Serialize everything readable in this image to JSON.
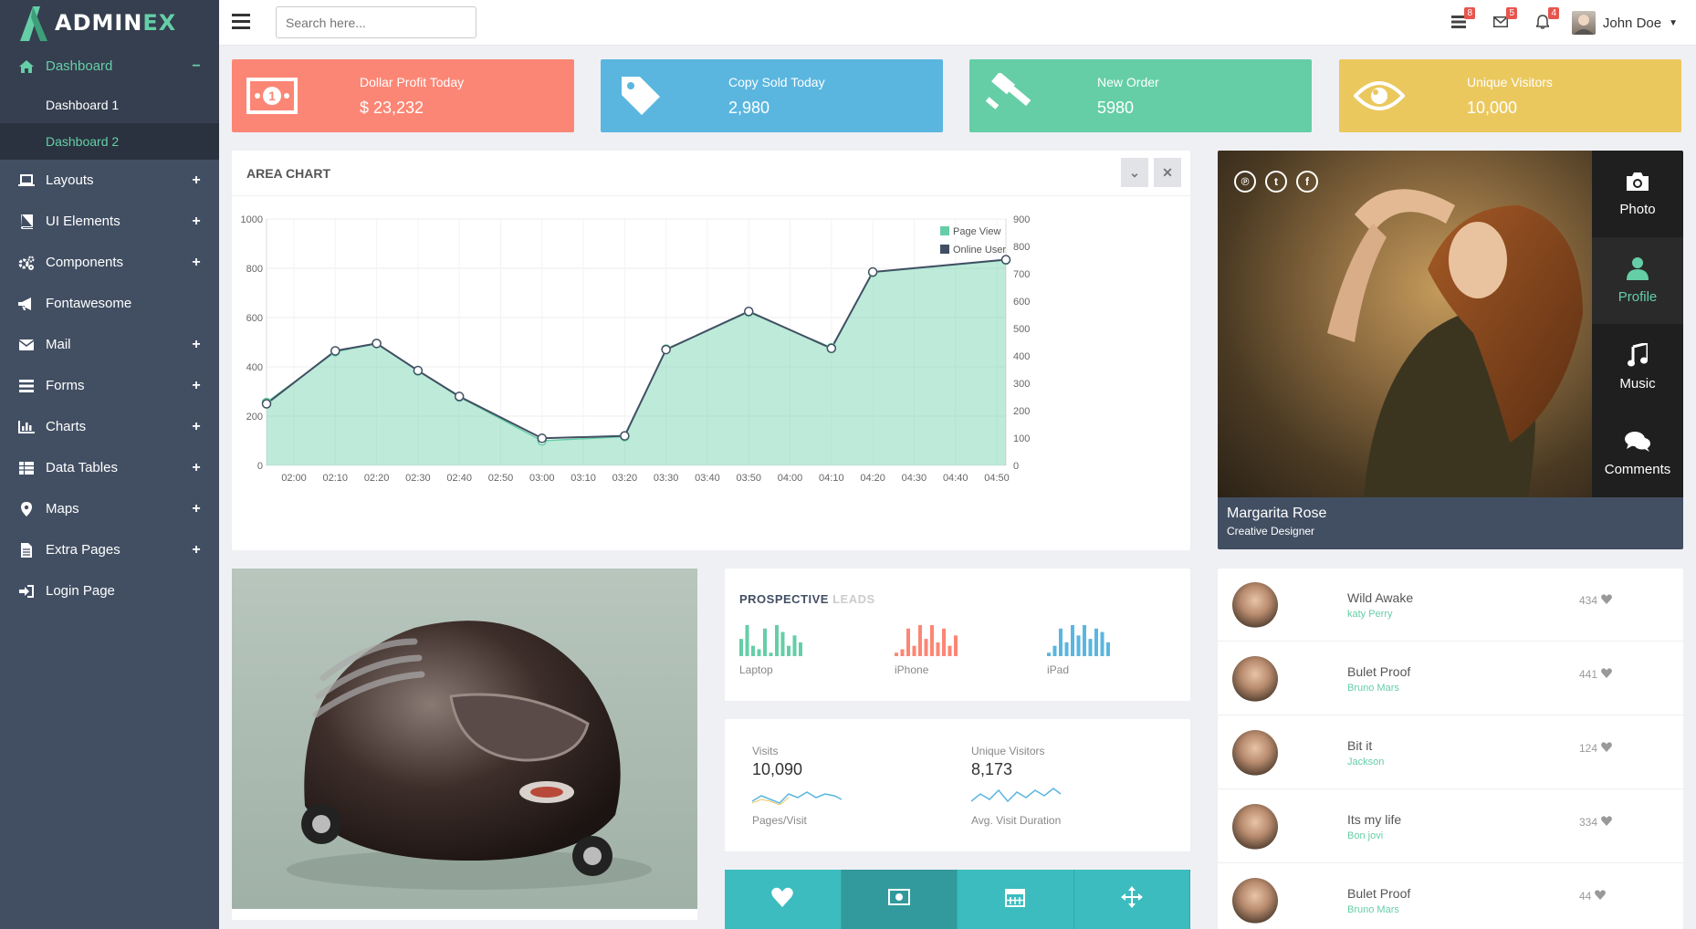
{
  "brand": {
    "name_a": "ADMIN",
    "name_b": "EX"
  },
  "sidebar": {
    "items": [
      {
        "label": "Dashboard",
        "icon": "home-icon",
        "toggle": "−"
      },
      {
        "label": "Layouts",
        "icon": "laptop-icon",
        "toggle": "+"
      },
      {
        "label": "UI Elements",
        "icon": "book-icon",
        "toggle": "+"
      },
      {
        "label": "Components",
        "icon": "cogs-icon",
        "toggle": "+"
      },
      {
        "label": "Fontawesome",
        "icon": "bullhorn-icon",
        "toggle": ""
      },
      {
        "label": "Mail",
        "icon": "envelope-icon",
        "toggle": "+"
      },
      {
        "label": "Forms",
        "icon": "tasks-icon",
        "toggle": "+"
      },
      {
        "label": "Charts",
        "icon": "bar-chart-icon",
        "toggle": "+"
      },
      {
        "label": "Data Tables",
        "icon": "table-icon",
        "toggle": "+"
      },
      {
        "label": "Maps",
        "icon": "map-marker-icon",
        "toggle": "+"
      },
      {
        "label": "Extra Pages",
        "icon": "file-icon",
        "toggle": "+"
      },
      {
        "label": "Login Page",
        "icon": "sign-in-icon",
        "toggle": ""
      }
    ],
    "sub": [
      "Dashboard 1",
      "Dashboard 2"
    ]
  },
  "header": {
    "search_placeholder": "Search here...",
    "badges": {
      "tasks": "8",
      "mail": "5",
      "bell": "4"
    },
    "user": "John Doe"
  },
  "stats": [
    {
      "title": "Dollar Profit Today",
      "value": "$ 23,232",
      "color": "#fc8675",
      "icon": "money-icon"
    },
    {
      "title": "Copy Sold Today",
      "value": "2,980",
      "color": "#5ab6df",
      "icon": "tag-icon"
    },
    {
      "title": "New Order",
      "value": "5980",
      "color": "#65cea7",
      "icon": "gavel-icon"
    },
    {
      "title": "Unique Visitors",
      "value": "10,000",
      "color": "#ebc85e",
      "icon": "eye-icon"
    }
  ],
  "area_chart_panel": {
    "title": "AREA CHART"
  },
  "chart_data": {
    "type": "area",
    "categories": [
      "02:00",
      "02:10",
      "02:20",
      "02:30",
      "02:40",
      "02:50",
      "03:00",
      "03:10",
      "03:20",
      "03:30",
      "03:40",
      "03:50",
      "04:00",
      "04:10",
      "04:20",
      "04:30",
      "04:40",
      "04:50"
    ],
    "x_points": [
      "02:00",
      "02:10",
      "02:20",
      "02:30",
      "02:40",
      "03:00",
      "03:20",
      "03:30",
      "03:50",
      "04:10",
      "04:20",
      "04:40",
      "04:50"
    ],
    "series": [
      {
        "name": "Page View",
        "axis": "left",
        "color": "#65cea7",
        "values": [
          250,
          465,
          495,
          385,
          280,
          110,
          120,
          470,
          625,
          475,
          785,
          835
        ]
      },
      {
        "name": "Online User",
        "axis": "right",
        "color": "#424f63",
        "values": [
          230,
          415,
          445,
          345,
          250,
          90,
          105,
          425,
          560,
          430,
          705,
          750
        ]
      }
    ],
    "left_ylim": [
      0,
      1000
    ],
    "left_ticks": [
      "0",
      "200",
      "400",
      "600",
      "800",
      "1000"
    ],
    "right_ylim": [
      0,
      900
    ],
    "right_ticks": [
      "0",
      "100",
      "200",
      "300",
      "400",
      "500",
      "600",
      "700",
      "800",
      "900"
    ],
    "legend": "top-right",
    "grid": true
  },
  "profile": {
    "name": "Margarita Rose",
    "role": "Creative Designer",
    "tabs": [
      {
        "label": "Photo",
        "icon": "camera-icon"
      },
      {
        "label": "Profile",
        "icon": "user-icon"
      },
      {
        "label": "Music",
        "icon": "music-icon"
      },
      {
        "label": "Comments",
        "icon": "comments-icon"
      }
    ],
    "social": [
      "pinterest-icon",
      "twitter-icon",
      "facebook-icon"
    ]
  },
  "leads": {
    "title_a": "PROSPECTIVE",
    "title_b": "LEADS",
    "items": [
      {
        "label": "Laptop",
        "color": "#65cea7",
        "bars": [
          5,
          9,
          3,
          2,
          8,
          1,
          9,
          7,
          3,
          6,
          4
        ]
      },
      {
        "label": "iPhone",
        "color": "#fc8675",
        "bars": [
          1,
          2,
          8,
          3,
          9,
          5,
          9,
          4,
          8,
          3,
          6
        ]
      },
      {
        "label": "iPad",
        "color": "#5ab6df",
        "bars": [
          1,
          3,
          8,
          4,
          9,
          6,
          9,
          5,
          8,
          7,
          4
        ]
      }
    ]
  },
  "visits": {
    "visits_label": "Visits",
    "visits_value": "10,090",
    "pages_label": "Pages/Visit",
    "unique_label": "Unique Visitors",
    "unique_value": "8,173",
    "duration_label": "Avg. Visit Duration"
  },
  "songs": [
    {
      "title": "Wild Awake",
      "artist": "katy Perry",
      "count": "434"
    },
    {
      "title": "Bulet Proof",
      "artist": "Bruno Mars",
      "count": "441"
    },
    {
      "title": "Bit it",
      "artist": "Jackson",
      "count": "124"
    },
    {
      "title": "Its my life",
      "artist": "Bon jovi",
      "count": "334"
    },
    {
      "title": "Bulet Proof",
      "artist": "Bruno Mars",
      "count": "44"
    }
  ]
}
